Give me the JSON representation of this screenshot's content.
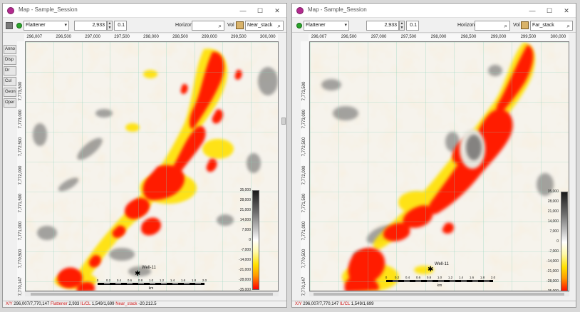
{
  "windows": [
    {
      "id": "left",
      "title": "Map - Sample_Session",
      "toolbar": {
        "mode": "Flattener",
        "value": "2,933",
        "step": "0.1",
        "horizon_label": "Horizon",
        "horizon_value": "",
        "vol_label": "Vol",
        "volume": "Near_stack"
      },
      "side_tabs": [
        "Anno",
        "Disp",
        "Dr",
        "Cul",
        "Geon",
        "Oper"
      ],
      "x_ticks": [
        "296,007",
        "296,500",
        "297,000",
        "297,500",
        "298,000",
        "298,500",
        "299,000",
        "299,500",
        "300,000"
      ],
      "y_ticks": [
        "7,773,500",
        "7,773,000",
        "7,772,500",
        "7,772,000",
        "7,771,500",
        "7,771,000",
        "7,770,500",
        "7,770,147"
      ],
      "colorbar_labels": [
        "35,000",
        "28,000",
        "21,000",
        "14,000",
        "7,000",
        "0",
        "-7,000",
        "-14,000",
        "-21,000",
        "-28,000",
        "-35,000"
      ],
      "well_label": "Well-11",
      "scale_ticks": [
        "0",
        "0.2",
        "0.4",
        "0.6",
        "0.8",
        "1.0",
        "1.2",
        "1.4",
        "1.6",
        "1.8",
        "2.0"
      ],
      "scale_unit": "km",
      "status": {
        "xy_label": "X/Y",
        "xy_value": "296,007/7,770,147",
        "flat_label": "Flattener",
        "flat_value": "2,933",
        "ilcl_label": "IL/CL",
        "ilcl_value": "1,549/1,699",
        "vol_label": "Near_stack",
        "vol_value": "-20,212.5"
      }
    },
    {
      "id": "right",
      "title": "Map - Sample_Session",
      "toolbar": {
        "mode": "Flattener",
        "value": "2,933",
        "step": "0.1",
        "horizon_label": "Horizon",
        "horizon_value": "",
        "vol_label": "Vol",
        "volume": "Far_stack"
      },
      "side_tabs": [],
      "x_ticks": [
        "296,007",
        "296,500",
        "297,000",
        "297,500",
        "298,000",
        "298,500",
        "299,000",
        "299,500",
        "300,000"
      ],
      "y_ticks": [
        "7,773,500",
        "7,773,000",
        "7,772,500",
        "7,772,000",
        "7,771,500",
        "7,771,000",
        "7,770,500",
        "7,770,147"
      ],
      "colorbar_labels": [
        "35,000",
        "28,000",
        "21,000",
        "14,000",
        "7,000",
        "0",
        "-7,000",
        "-14,000",
        "-21,000",
        "-28,000",
        "-35,000"
      ],
      "well_label": "Well-11",
      "scale_ticks": [
        "0",
        "0.2",
        "0.4",
        "0.6",
        "0.8",
        "1.0",
        "1.2",
        "1.4",
        "1.6",
        "1.8",
        "2.0"
      ],
      "scale_unit": "km",
      "status": {
        "xy_label": "X/Y",
        "xy_value": "296,007/7,770,147",
        "flat_label": "",
        "flat_value": "",
        "ilcl_label": "IL/CL",
        "ilcl_value": "1,549/1,699",
        "vol_label": "",
        "vol_value": ""
      }
    }
  ],
  "colors": {
    "accent_red": "#ff1a00",
    "amp_yellow": "#ffe100",
    "amp_gray": "#6e6e6e",
    "grid": "#88d2b8",
    "well_pin": "#000000"
  },
  "icons": [
    "app-icon",
    "minimize-icon",
    "maximize-icon",
    "close-icon",
    "search-icon",
    "volume-icon",
    "chevron-down-icon"
  ]
}
